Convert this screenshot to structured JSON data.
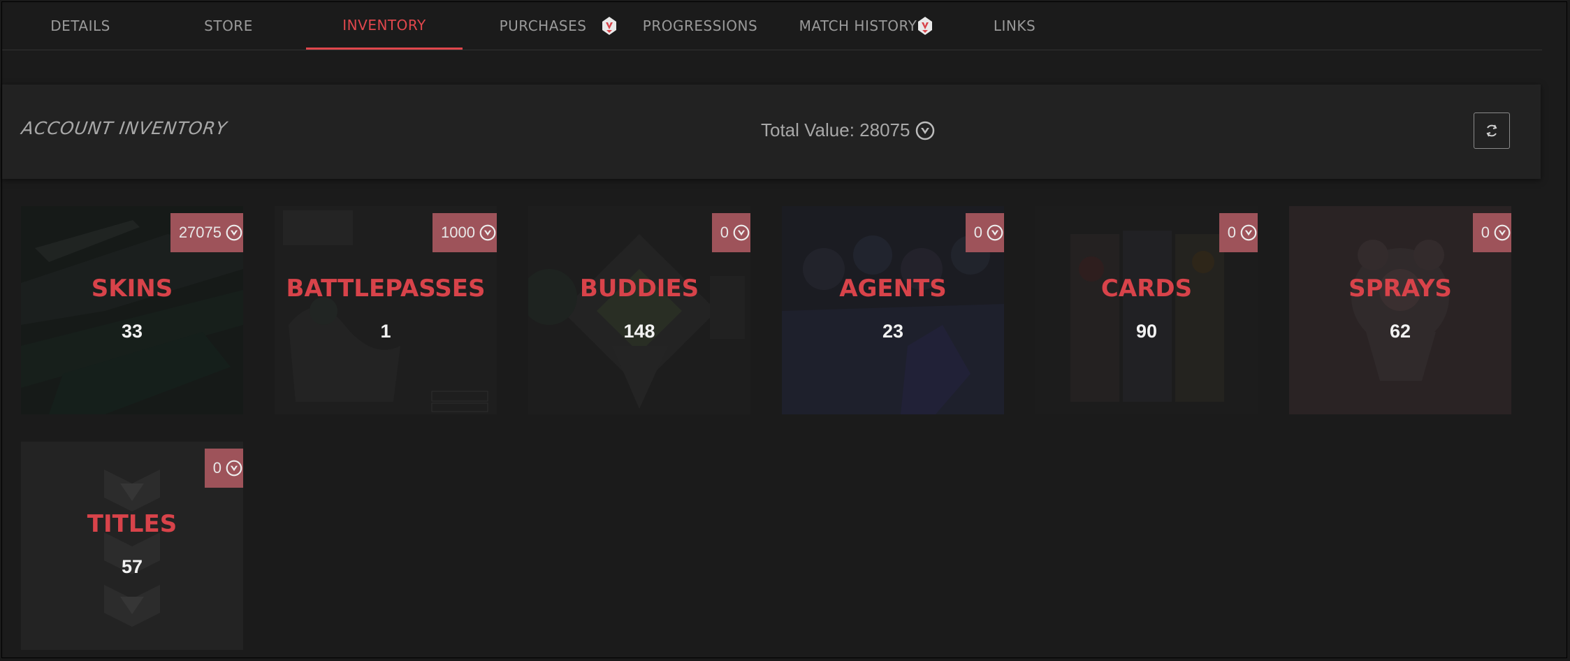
{
  "tabs": [
    {
      "label": "DETAILS",
      "active": false
    },
    {
      "label": "STORE",
      "active": false
    },
    {
      "label": "INVENTORY",
      "active": true
    },
    {
      "label": "PURCHASES",
      "active": false,
      "badge": "valorant-icon"
    },
    {
      "label": "PROGRESSIONS",
      "active": false
    },
    {
      "label": "MATCH HISTORY",
      "active": false,
      "badge": "valorant-icon"
    },
    {
      "label": "LINKS",
      "active": false
    }
  ],
  "header": {
    "title": "ACCOUNT INVENTORY",
    "total_value_label": "Total Value: 28075",
    "currency_icon": "valorant-points-icon",
    "refresh_icon": "refresh-icon"
  },
  "cards": [
    {
      "category": "SKINS",
      "count": "33",
      "value": "27075"
    },
    {
      "category": "BATTLEPASSES",
      "count": "1",
      "value": "1000"
    },
    {
      "category": "BUDDIES",
      "count": "148",
      "value": "0"
    },
    {
      "category": "AGENTS",
      "count": "23",
      "value": "0"
    },
    {
      "category": "CARDS",
      "count": "90",
      "value": "0"
    },
    {
      "category": "SPRAYS",
      "count": "62",
      "value": "0"
    },
    {
      "category": "TITLES",
      "count": "57",
      "value": "0"
    }
  ],
  "colors": {
    "accent": "#e0474c",
    "category_text": "#d8434a",
    "badge_bg": "#9e535a",
    "background": "#1b1b1b",
    "panel": "#222222"
  }
}
